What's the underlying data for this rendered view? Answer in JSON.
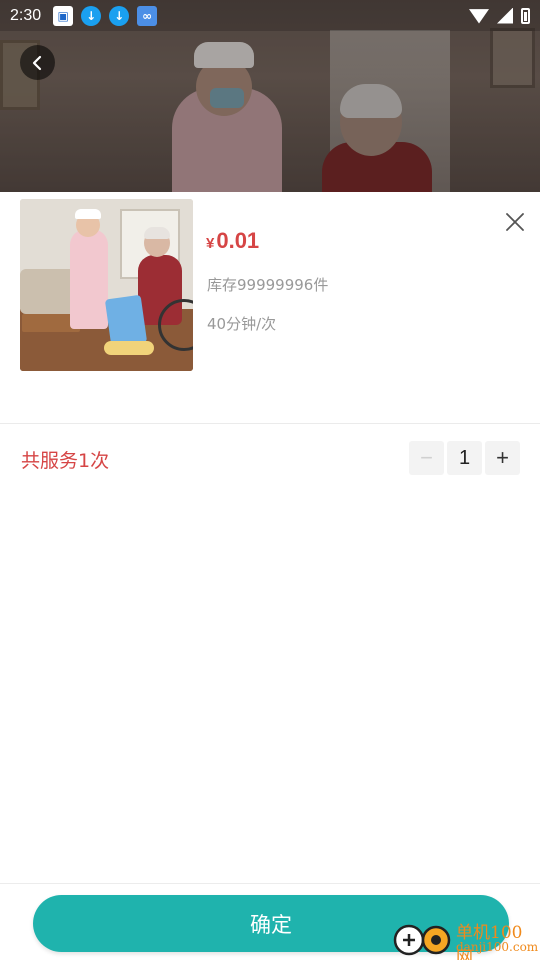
{
  "status_bar": {
    "time": "2:30",
    "notifications": [
      "app-notification-icon",
      "download-icon",
      "download-icon",
      "glasses-app-icon"
    ],
    "right_icons": [
      "wifi-icon",
      "signal-icon",
      "battery-icon"
    ]
  },
  "header": {
    "back_icon": "chevron-left-icon"
  },
  "product": {
    "price_currency": "¥",
    "price": "0.01",
    "stock": "库存99999996件",
    "duration": "40分钟/次",
    "close_icon": "close-icon"
  },
  "service": {
    "count_label": "共服务1次",
    "quantity": "1",
    "minus": "−",
    "plus": "+"
  },
  "footer": {
    "confirm_label": "确定"
  },
  "watermark": {
    "brand": "单机100网",
    "domain": "danji100.com"
  },
  "colors": {
    "price": "#d64545",
    "accent": "#1fb3ad",
    "muted_text": "#999999"
  }
}
